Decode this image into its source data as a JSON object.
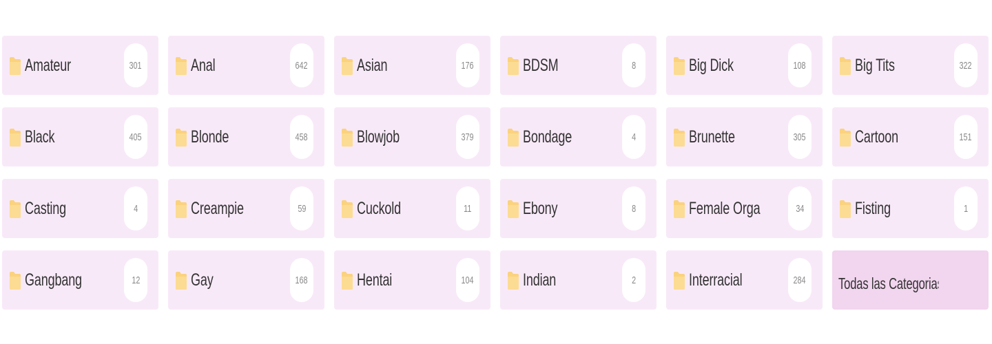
{
  "categories": [
    {
      "name": "Amateur",
      "count": "301"
    },
    {
      "name": "Anal",
      "count": "642"
    },
    {
      "name": "Asian",
      "count": "176"
    },
    {
      "name": "BDSM",
      "count": "8"
    },
    {
      "name": "Big Dick",
      "count": "108"
    },
    {
      "name": "Big Tits",
      "count": "322"
    },
    {
      "name": "Black",
      "count": "405"
    },
    {
      "name": "Blonde",
      "count": "458"
    },
    {
      "name": "Blowjob",
      "count": "379"
    },
    {
      "name": "Bondage",
      "count": "4"
    },
    {
      "name": "Brunette",
      "count": "305"
    },
    {
      "name": "Cartoon",
      "count": "151"
    },
    {
      "name": "Casting",
      "count": "4"
    },
    {
      "name": "Creampie",
      "count": "59"
    },
    {
      "name": "Cuckold",
      "count": "11"
    },
    {
      "name": "Ebony",
      "count": "8"
    },
    {
      "name": "Female Orgasm",
      "count": "34"
    },
    {
      "name": "Fisting",
      "count": "1"
    },
    {
      "name": "Gangbang",
      "count": "12"
    },
    {
      "name": "Gay",
      "count": "168"
    },
    {
      "name": "Hentai",
      "count": "104"
    },
    {
      "name": "Indian",
      "count": "2"
    },
    {
      "name": "Interracial",
      "count": "284"
    }
  ],
  "all_categories_label": "Todas las Categorias",
  "icons": {
    "category": "folder-icon"
  },
  "colors": {
    "tile_background": "#f8e9f8",
    "all_tile_background": "#f2d5ef",
    "folder": "#fbd27e",
    "label_text": "#333333",
    "count_text": "#8a8a8a"
  }
}
